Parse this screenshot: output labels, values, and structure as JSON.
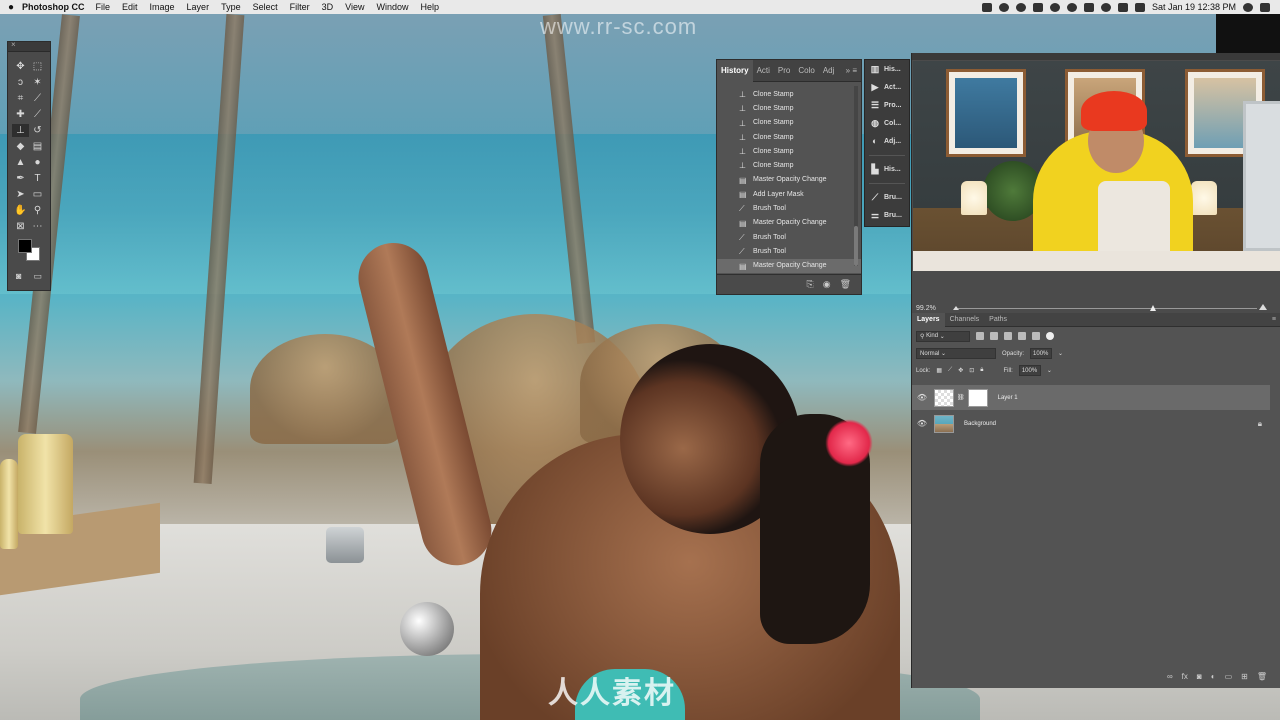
{
  "menubar": {
    "app_name": "Photoshop CC",
    "menus": [
      "File",
      "Edit",
      "Image",
      "Layer",
      "Type",
      "Select",
      "Filter",
      "3D",
      "View",
      "Window",
      "Help"
    ],
    "clock": "Sat Jan 19  12:38 PM"
  },
  "watermark": {
    "url": "www.rr-sc.com",
    "logo_text": "人人素材"
  },
  "history_panel": {
    "tabs": [
      "History",
      "Acti",
      "Pro",
      "Colo",
      "Adj"
    ],
    "items": [
      {
        "label": "Clone Stamp",
        "icon": "stamp-icon"
      },
      {
        "label": "Clone Stamp",
        "icon": "stamp-icon"
      },
      {
        "label": "Clone Stamp",
        "icon": "stamp-icon"
      },
      {
        "label": "Clone Stamp",
        "icon": "stamp-icon"
      },
      {
        "label": "Clone Stamp",
        "icon": "stamp-icon"
      },
      {
        "label": "Clone Stamp",
        "icon": "stamp-icon"
      },
      {
        "label": "Master Opacity Change",
        "icon": "document-icon"
      },
      {
        "label": "Add Layer Mask",
        "icon": "document-icon"
      },
      {
        "label": "Brush Tool",
        "icon": "brush-icon"
      },
      {
        "label": "Master Opacity Change",
        "icon": "document-icon"
      },
      {
        "label": "Brush Tool",
        "icon": "brush-icon"
      },
      {
        "label": "Brush Tool",
        "icon": "brush-icon"
      },
      {
        "label": "Master Opacity Change",
        "icon": "document-icon",
        "selected": true
      }
    ]
  },
  "dock": {
    "items": [
      {
        "label": "His...",
        "icon": "histogram-icon"
      },
      {
        "label": "Act...",
        "icon": "play-icon"
      },
      {
        "label": "Pro...",
        "icon": "properties-icon"
      },
      {
        "label": "Col...",
        "icon": "color-icon"
      },
      {
        "label": "Adj...",
        "icon": "adjustments-icon"
      },
      {
        "label": "His...",
        "icon": "history-icon"
      },
      {
        "label": "Bru...",
        "icon": "brush-icon"
      },
      {
        "label": "Bru...",
        "icon": "brush-settings-icon"
      }
    ]
  },
  "navigator": {
    "zoom": "99.2%"
  },
  "layers_panel": {
    "tabs": [
      "Layers",
      "Channels",
      "Paths"
    ],
    "filter_kind": "Kind",
    "blend_mode": "Normal",
    "opacity_label": "Opacity:",
    "opacity_value": "100%",
    "lock_label": "Lock:",
    "fill_label": "Fill:",
    "fill_value": "100%",
    "layers": [
      {
        "name": "Layer 1",
        "selected": true
      },
      {
        "name": "Background",
        "locked": true
      }
    ]
  }
}
